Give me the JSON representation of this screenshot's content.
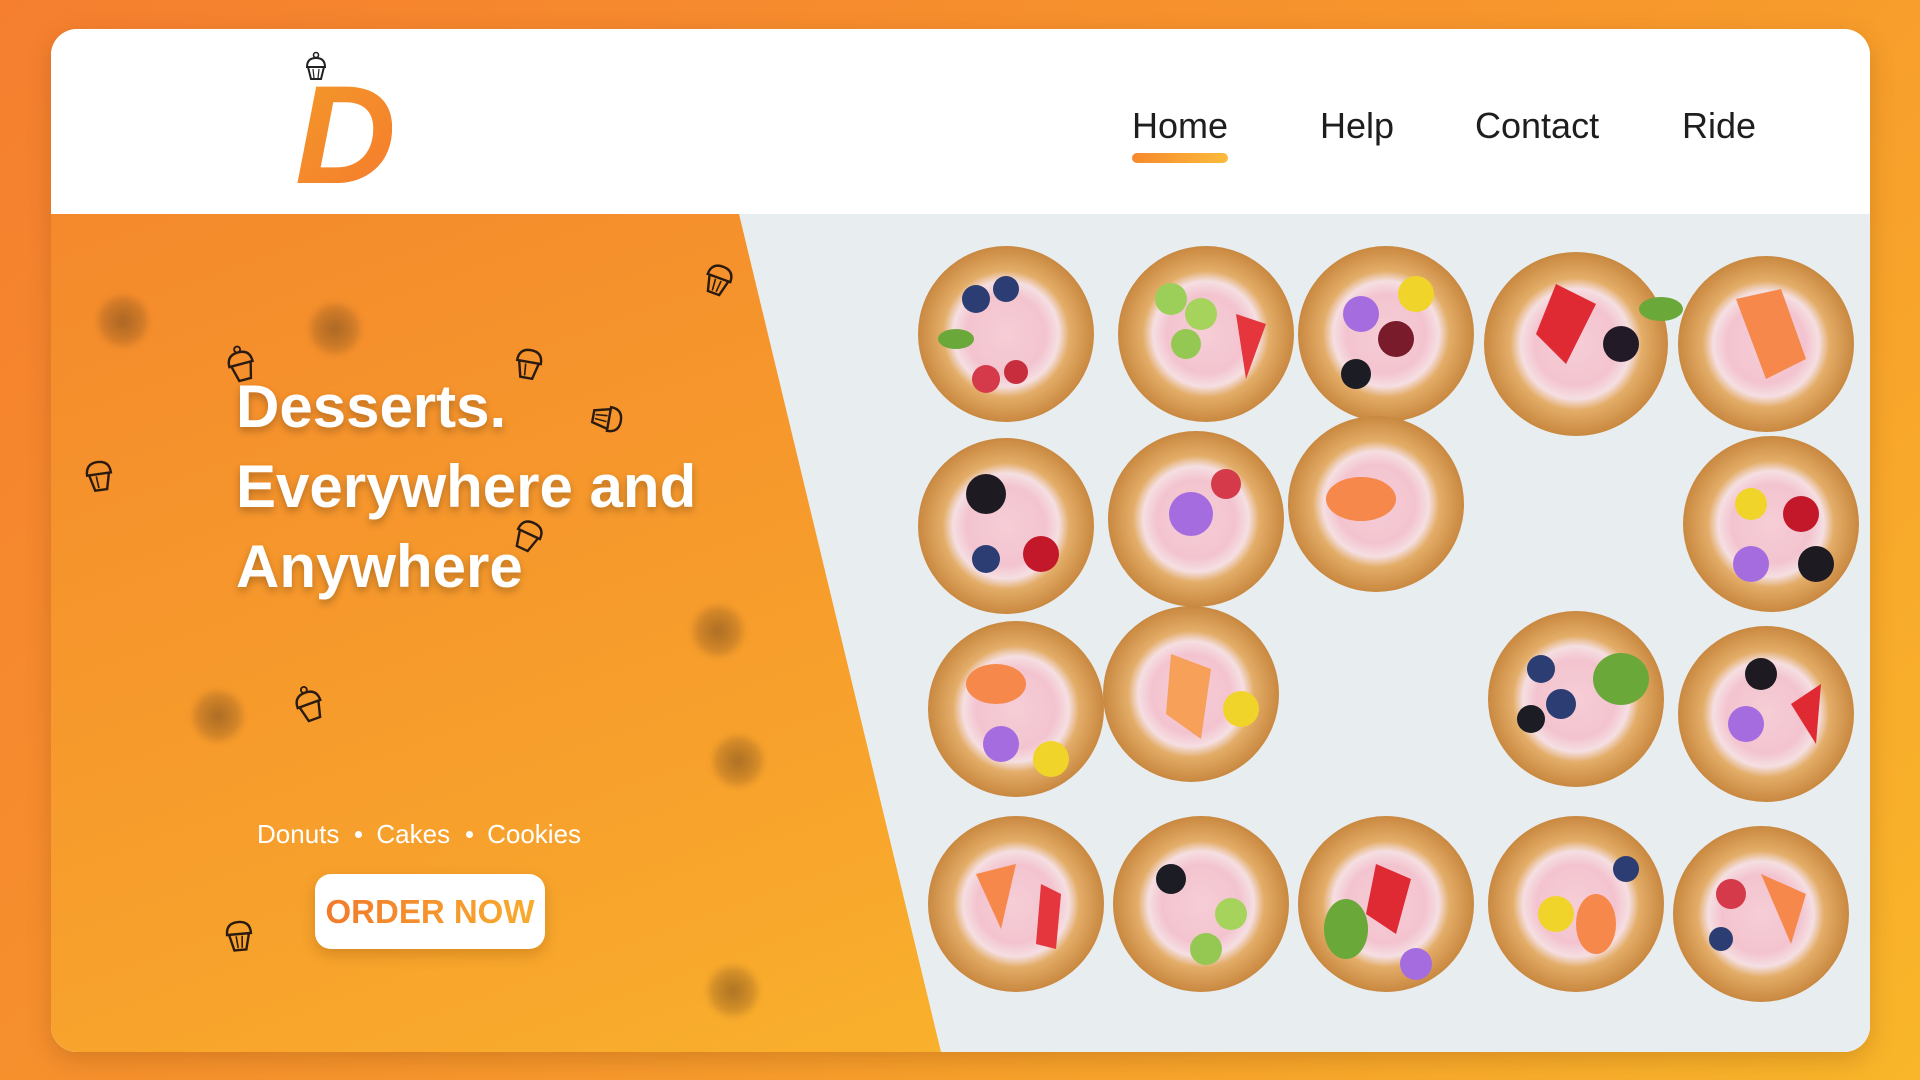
{
  "brand": {
    "logo_letter": "D"
  },
  "nav": {
    "items": [
      {
        "label": "Home",
        "active": true
      },
      {
        "label": "Help",
        "active": false
      },
      {
        "label": "Contact",
        "active": false
      },
      {
        "label": "Ride",
        "active": false
      }
    ]
  },
  "hero": {
    "title_lines": [
      "Desserts.",
      "Everywhere and",
      "Anywhere"
    ],
    "categories": [
      "Donuts",
      "Cakes",
      "Cookies"
    ],
    "cta_label": "ORDER NOW",
    "image_subject": "frosted donuts with fruit and flowers"
  },
  "colors": {
    "accent_orange": "#f4892c",
    "accent_yellow": "#fbbd2c",
    "nav_text": "#1e1e1e",
    "card_background": "#ffffff"
  },
  "icons": [
    "cupcake-icon"
  ]
}
